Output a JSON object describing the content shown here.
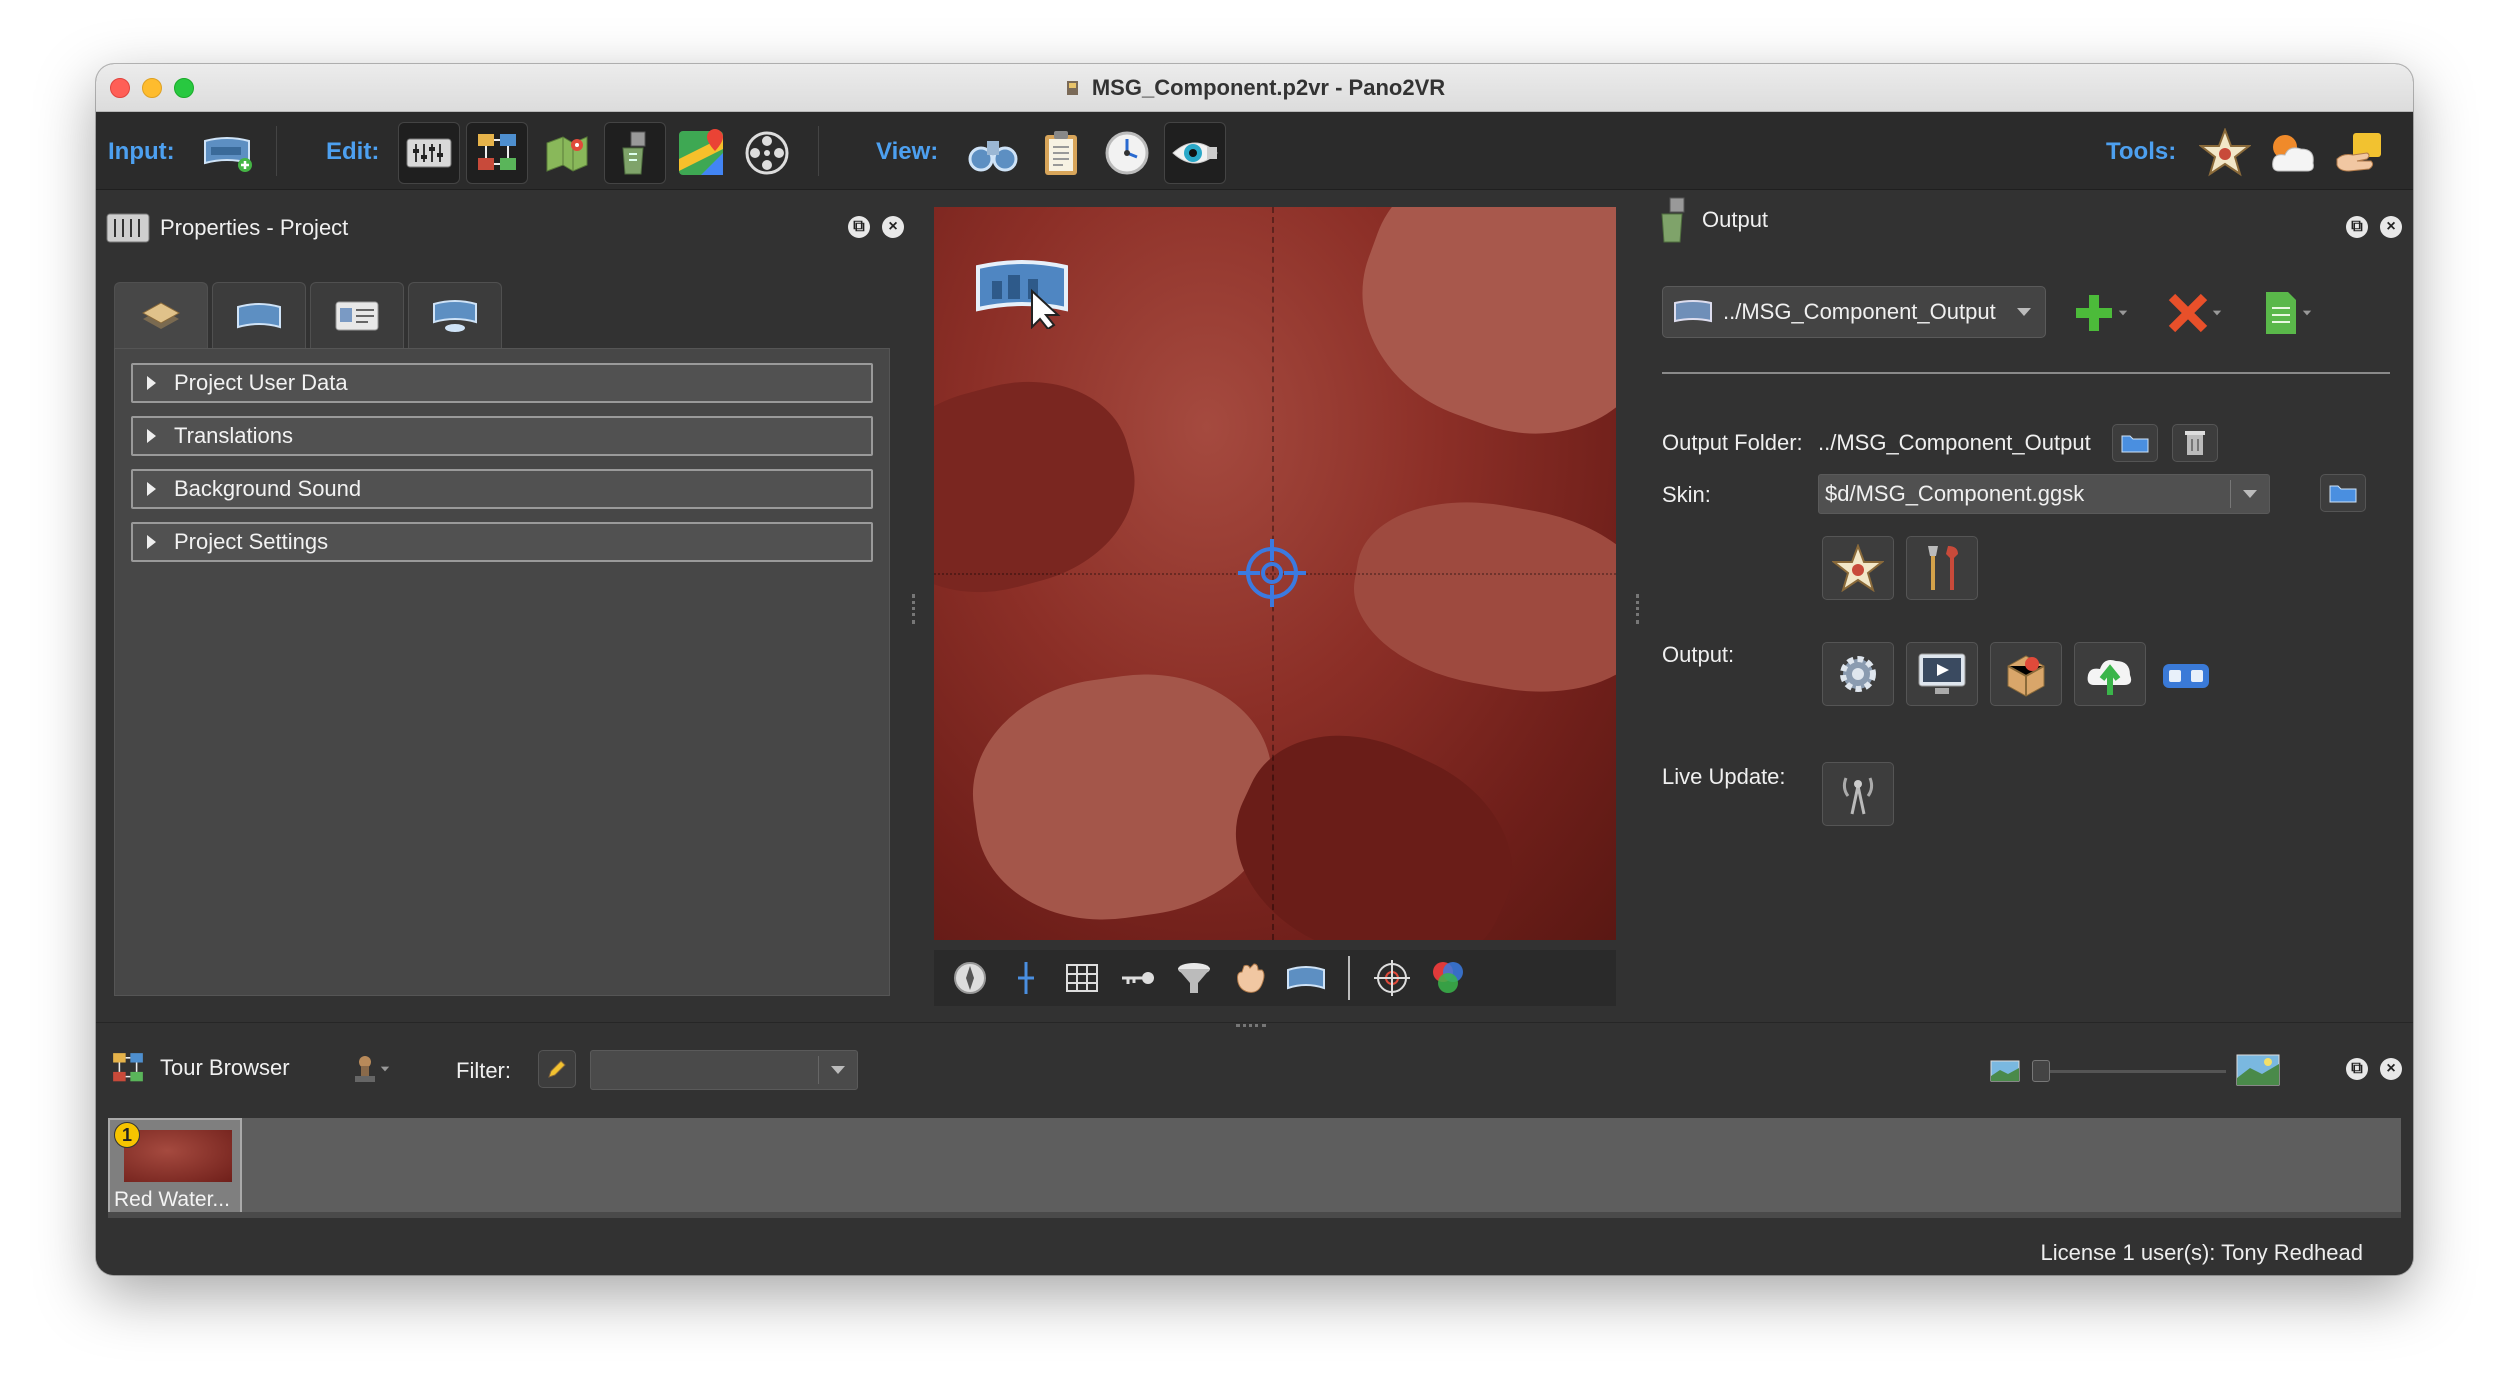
{
  "window": {
    "title": "MSG_Component.p2vr - Pano2VR"
  },
  "toolbar": {
    "input_label": "Input:",
    "edit_label": "Edit:",
    "view_label": "View:",
    "tools_label": "Tools:",
    "input_buttons": [
      "add-panorama-icon"
    ],
    "edit_buttons": [
      "properties-icon",
      "tour-browser-icon",
      "map-icon",
      "skin-editor-icon",
      "google-maps-icon",
      "animation-reel-icon"
    ],
    "view_buttons": [
      "binoculars-icon",
      "clipboard-icon",
      "clock-icon",
      "eye-icon"
    ],
    "tools_buttons": [
      "tool-star-icon",
      "tool-weather-icon",
      "tool-hand-icon"
    ]
  },
  "properties": {
    "title": "Properties - Project",
    "tabs": [
      "project-tab",
      "viewing-params-tab",
      "user-data-tab",
      "hotspot-tab"
    ],
    "sections": [
      "Project User Data",
      "Translations",
      "Background Sound",
      "Project Settings"
    ]
  },
  "viewer": {
    "toolbar_icons": [
      "compass-icon",
      "plus-line-icon",
      "grid-icon",
      "key-icon",
      "funnel-icon",
      "hand-icon",
      "panorama-icon",
      "target-icon",
      "color-circles-icon"
    ]
  },
  "output": {
    "title": "Output",
    "selected_output": "../MSG_Component_Output",
    "output_folder_label": "Output Folder:",
    "output_folder_value": "../MSG_Component_Output",
    "skin_label": "Skin:",
    "skin_value": "$d/MSG_Component.ggsk",
    "output_label": "Output:",
    "live_update_label": "Live Update:"
  },
  "tour_browser": {
    "title": "Tour Browser",
    "filter_label": "Filter:",
    "filter_value": "",
    "items": [
      {
        "label": "Red Water...",
        "badge": "1"
      }
    ]
  },
  "status": {
    "license": "License 1 user(s): Tony Redhead"
  },
  "colors": {
    "accent": "#4da0f0",
    "panel_bg": "#323232",
    "viewer_red": "#8c2f27"
  }
}
